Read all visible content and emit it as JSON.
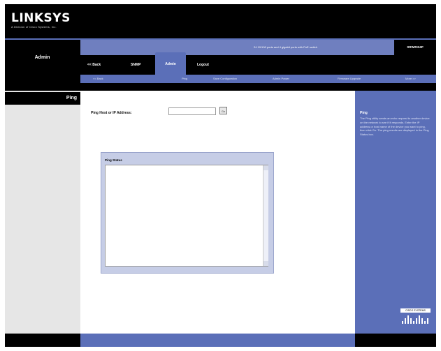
{
  "brand": {
    "name": "LINKSYS",
    "tagline": "A Division of Cisco Systems, Inc."
  },
  "header": {
    "section_title": "Admin",
    "product_description": "24 10/100 ports and 4 gigabit ports with PoE switch",
    "model": "SRW2024P"
  },
  "main_tabs": [
    {
      "label": "<< Back",
      "active": false
    },
    {
      "label": "SNMP",
      "active": false
    },
    {
      "label": "Admin",
      "active": true
    },
    {
      "label": "Logout",
      "active": false
    }
  ],
  "sub_tabs": [
    {
      "label": "<< Back"
    },
    {
      "label": "Ping"
    },
    {
      "label": "Save Configuration"
    },
    {
      "label": "Admin Power"
    },
    {
      "label": "Firmware Upgrade"
    },
    {
      "label": "More >>"
    }
  ],
  "left": {
    "page_label": "Ping"
  },
  "form": {
    "host_label": "Ping Host or IP Address:",
    "host_value": "",
    "host_placeholder": "",
    "go_label": "Go",
    "status_title": "Ping Status",
    "status_text": ""
  },
  "help": {
    "title": "Ping",
    "text": "The Ping utility sends an echo request to another device on the network to see if it responds. Enter the IP address or host name of the device you want to ping, then click Go. The ping results are displayed in the Ping Status box."
  },
  "cisco": {
    "label": "CISCO SYSTEMS"
  },
  "colors": {
    "accent": "#5b6fb8",
    "product_bar": "#6f7fbf",
    "status_panel": "#c6cde6",
    "left_panel": "#e6e6e6"
  }
}
